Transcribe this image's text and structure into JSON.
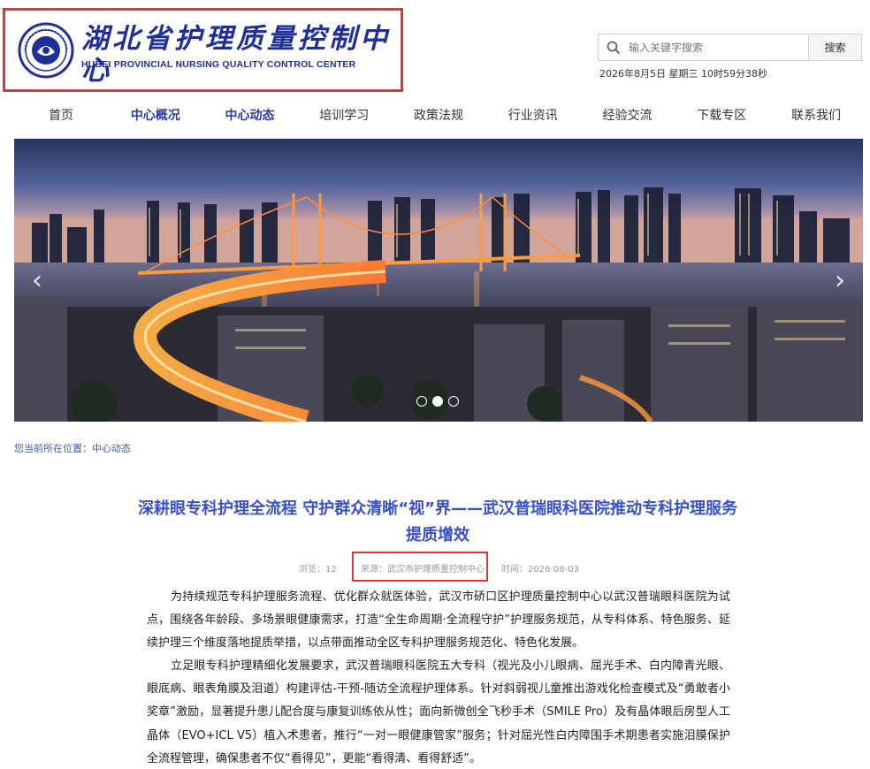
{
  "header": {
    "logo_cn": "湖北省护理质量控制中心",
    "logo_en": "HUBEI PROVINCIAL NURSING QUALITY CONTROL CENTER",
    "search_placeholder": "输入关键字搜索",
    "search_button": "搜索",
    "datetime": "2026年8月5日 星期三 10时59分38秒"
  },
  "nav": {
    "items": [
      "首页",
      "中心概况",
      "中心动态",
      "培训学习",
      "政策法规",
      "行业资讯",
      "经验交流",
      "下载专区",
      "联系我们"
    ],
    "active": [
      "中心概况",
      "中心动态"
    ]
  },
  "banner": {
    "slide_count": 3,
    "active_slide": 2,
    "prev_icon": "chevron-left-icon",
    "next_icon": "chevron-right-icon"
  },
  "breadcrumb": {
    "prefix": "您当前所在位置：",
    "current": "中心动态"
  },
  "article": {
    "title": "深耕眼专科护理全流程 守护群众清晰“视”界——武汉普瑞眼科医院推动专科护理服务提质增效",
    "views": "浏览：12",
    "source": "来源：武汉市护理质量控制中心",
    "time": "时间：2026-08-03",
    "paragraphs": [
      "为持续规范专科护理服务流程、优化群众就医体验，武汉市硚口区护理质量控制中心以武汉普瑞眼科医院为试点，围绕各年龄段、多场景眼健康需求，打造“全生命周期·全流程守护”护理服务规范，从专科体系、特色服务、延续护理三个维度落地提质举措，以点带面推动全区专科护理服务规范化、特色化发展。",
      "立足眼专科护理精细化发展要求，武汉普瑞眼科医院五大专科（视光及小儿眼病、屈光手术、白内障青光眼、眼底病、眼表角膜及泪道）构建评估-干预-随访全流程护理体系。针对斜弱视儿童推出游戏化检查模式及“勇敢者小奖章”激励，显著提升患儿配合度与康复训练依从性；面向新微创全飞秒手术（SMILE Pro）及有晶体眼后房型人工晶体（EVO+ICL V5）植入术患者，推行“一对一眼健康管家”服务；针对屈光性白内障围手术期患者实施泪膜保护全流程管理，确保患者不仅“看得见”，更能“看得清、看得舒适”。"
    ]
  },
  "colors": {
    "brand_blue": "#1e2f9a",
    "title_blue": "#3a50c8",
    "highlight_red": "#e0353b"
  }
}
